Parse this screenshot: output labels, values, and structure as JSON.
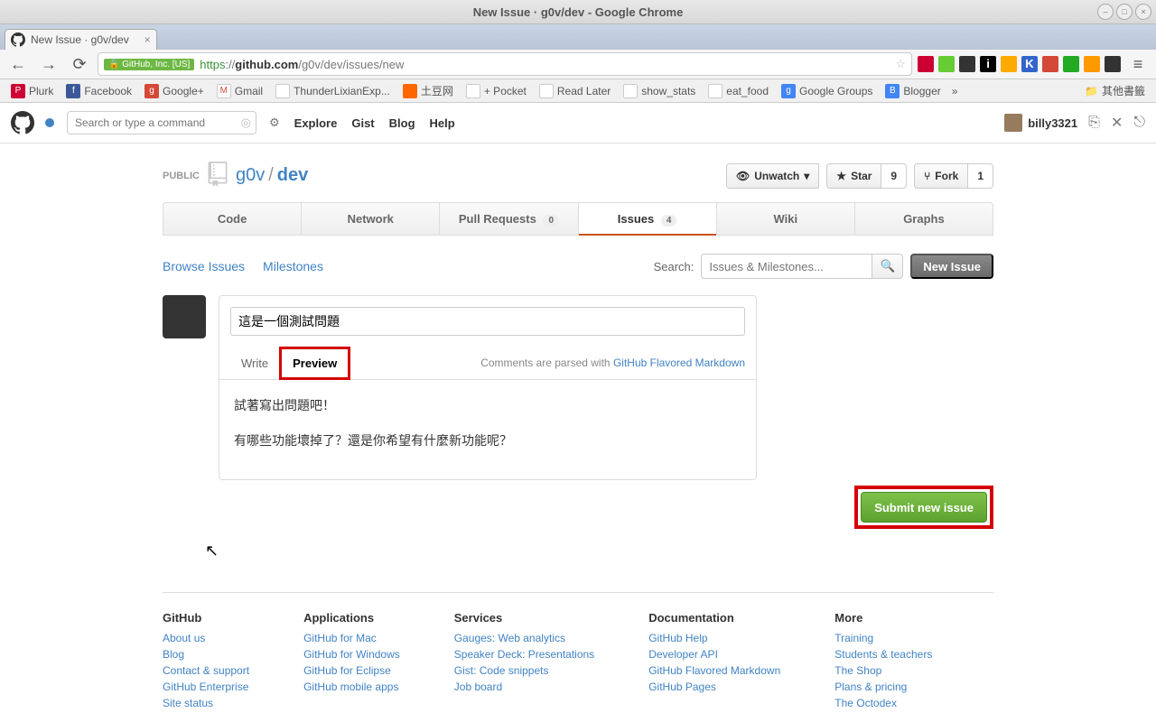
{
  "window": {
    "title": "New Issue ·  g0v/dev - Google Chrome"
  },
  "tab": {
    "title": "New Issue ·  g0v/dev"
  },
  "urlbar": {
    "identity": "GitHub, Inc. [US]",
    "scheme": "https",
    "host": "github.com",
    "path": "/g0v/dev/issues/new"
  },
  "bookmarks": [
    {
      "label": "Plurk",
      "color": "#c03"
    },
    {
      "label": "Facebook",
      "color": "#3b5998"
    },
    {
      "label": "Google+",
      "color": "#d34836"
    },
    {
      "label": "Gmail",
      "color": "#d34836"
    },
    {
      "label": "ThunderLixianExp...",
      "color": "#fff"
    },
    {
      "label": "土豆网",
      "color": "#f60"
    },
    {
      "label": "+ Pocket",
      "color": "#fff"
    },
    {
      "label": "Read Later",
      "color": "#fff"
    },
    {
      "label": "show_stats",
      "color": "#fff"
    },
    {
      "label": "eat_food",
      "color": "#fff"
    },
    {
      "label": "Google Groups",
      "color": "#4285f4"
    },
    {
      "label": "Blogger",
      "color": "#4285f4"
    }
  ],
  "bookmark_overflow": "»",
  "bookmark_folder": "其他書籤",
  "gh": {
    "search_placeholder": "Search or type a command",
    "nav": {
      "explore": "Explore",
      "gist": "Gist",
      "blog": "Blog",
      "help": "Help"
    },
    "username": "billy3321"
  },
  "repo": {
    "visibility": "PUBLIC",
    "owner": "g0v",
    "name": "dev",
    "unwatch": "Unwatch",
    "star": "Star",
    "star_count": "9",
    "fork": "Fork",
    "fork_count": "1"
  },
  "tabs": {
    "code": "Code",
    "network": "Network",
    "pull": "Pull Requests",
    "pull_count": "0",
    "issues": "Issues",
    "issues_count": "4",
    "wiki": "Wiki",
    "graphs": "Graphs"
  },
  "subnav": {
    "browse": "Browse Issues",
    "milestones": "Milestones",
    "search_label": "Search:",
    "search_placeholder": "Issues & Milestones...",
    "new_issue": "New Issue"
  },
  "issue": {
    "title_value": "這是一個測試問題",
    "write": "Write",
    "preview": "Preview",
    "parse_prefix": "Comments are parsed with ",
    "parse_link": "GitHub Flavored Markdown",
    "preview_line1": "試著寫出問題吧！",
    "preview_line2": "有哪些功能壞掉了？還是你希望有什麼新功能呢？",
    "submit": "Submit new issue"
  },
  "footer": {
    "c1_title": "GitHub",
    "c1": [
      "About us",
      "Blog",
      "Contact & support",
      "GitHub Enterprise",
      "Site status"
    ],
    "c2_title": "Applications",
    "c2": [
      "GitHub for Mac",
      "GitHub for Windows",
      "GitHub for Eclipse",
      "GitHub mobile apps"
    ],
    "c3_title": "Services",
    "c3": [
      "Gauges: Web analytics",
      "Speaker Deck: Presentations",
      "Gist: Code snippets",
      "Job board"
    ],
    "c4_title": "Documentation",
    "c4": [
      "GitHub Help",
      "Developer API",
      "GitHub Flavored Markdown",
      "GitHub Pages"
    ],
    "c5_title": "More",
    "c5": [
      "Training",
      "Students & teachers",
      "The Shop",
      "Plans & pricing",
      "The Octodex"
    ]
  }
}
